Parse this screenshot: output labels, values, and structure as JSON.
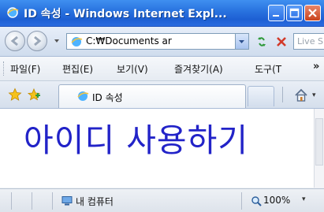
{
  "window": {
    "title": "ID 속성 - Windows Internet Expl..."
  },
  "address_bar": {
    "url": "C:₩Documents ar",
    "search_placeholder": "Live S"
  },
  "menu": {
    "items": [
      {
        "label": "파일(F)"
      },
      {
        "label": "편집(E)"
      },
      {
        "label": "보기(V)"
      },
      {
        "label": "즐겨찾기(A)"
      },
      {
        "label": "도구(T"
      }
    ],
    "overflow": "»"
  },
  "tab": {
    "label": "ID 속성"
  },
  "content": {
    "headline": "아이디 사용하기"
  },
  "status_bar": {
    "zone": "내 컴퓨터",
    "zoom": "100%"
  },
  "icons": {
    "ie": "ie-logo-icon",
    "back": "back-arrow-icon",
    "forward": "forward-arrow-icon",
    "refresh": "refresh-icon",
    "stop": "stop-icon",
    "favorites": "favorites-star-icon",
    "add_favorite": "add-favorite-icon",
    "home": "home-icon",
    "zone": "computer-zone-icon",
    "zoom": "zoom-icon"
  },
  "colors": {
    "title_bar": "#2a6be0",
    "headline": "#2223c8",
    "close_button": "#c9421c"
  }
}
